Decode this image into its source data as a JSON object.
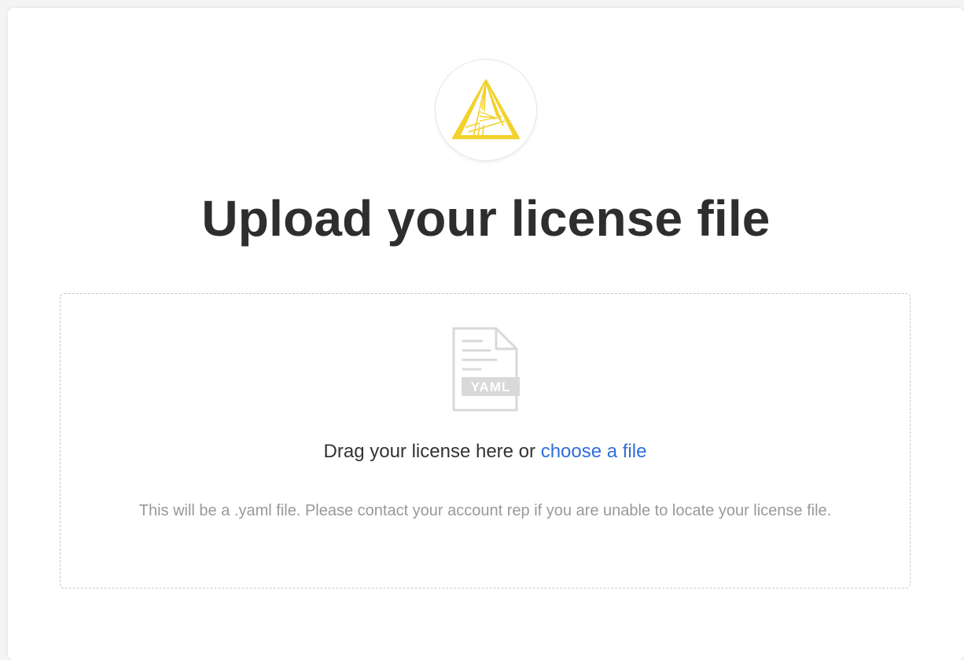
{
  "logo": {
    "icon": "triangle-logo-icon",
    "color": "#f2d12b"
  },
  "page": {
    "title": "Upload your license file"
  },
  "dropzone": {
    "file_icon": "yaml-file-icon",
    "file_icon_label": "YAML",
    "drag_text": "Drag your license here or",
    "choose_link": "choose a file",
    "help_text": "This will be a .yaml file. Please contact your account rep if you are unable to locate your license file.",
    "link_color": "#2f6fd9"
  }
}
